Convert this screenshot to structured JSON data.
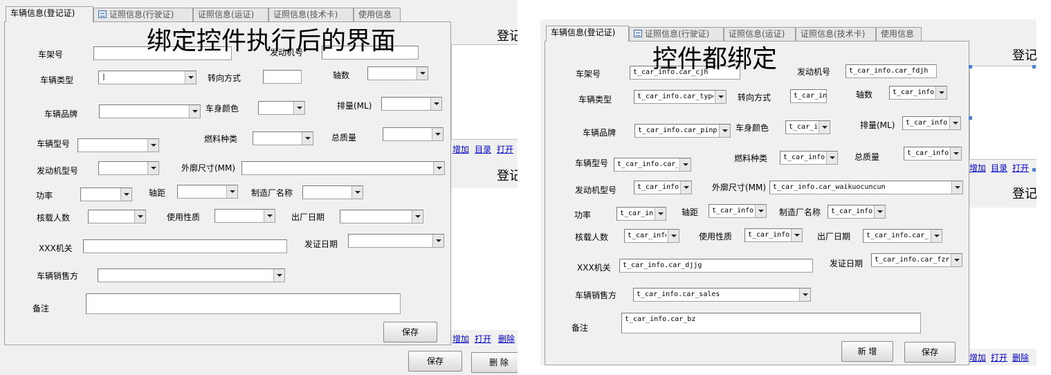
{
  "left": {
    "tabs": [
      {
        "label": "车辆信息(登记证)",
        "active": true
      },
      {
        "label": "证照信息(行驶证)",
        "icon": "document-icon"
      },
      {
        "label": "证照信息(运证)"
      },
      {
        "label": "证照信息(技术卡)"
      },
      {
        "label": "使用信息"
      }
    ],
    "caption": "绑定控件执行后的界面",
    "labels": {
      "cjh": "车架号",
      "fdjh": "发动机号",
      "cllx": "车辆类型",
      "zxfs": "转向方式",
      "zs": "轴数",
      "clpp": "车辆品牌",
      "csys": "车身颜色",
      "pl": "排量(ML)",
      "clxh": "车辆型号",
      "rlzl": "燃料种类",
      "zzl": "总质量",
      "fdjxh": "发动机型号",
      "wkcc": "外廓尺寸(MM)",
      "gl": "功率",
      "zj": "轴距",
      "zzcmc": "制造厂名称",
      "hzrs": "核载人数",
      "syxz": "使用性质",
      "ccrq": "出厂日期",
      "djjg": "XXX机关",
      "fzrq": "发证日期",
      "clxsf": "车辆销售方",
      "bz": "备注"
    },
    "values": {
      "cllx": "|"
    },
    "save_button": "保存",
    "bottom_save_button": "保存",
    "delete_button": "删 除",
    "side_title_1": "登记",
    "side_title_2": "登记",
    "links_top": [
      "增加",
      "目录",
      "打开"
    ],
    "links_bottom": [
      "增加",
      "打开",
      "删除"
    ]
  },
  "right": {
    "tabs": [
      {
        "label": "车辆信息(登记证)",
        "active": true
      },
      {
        "label": "证照信息(行驶证)",
        "icon": "document-icon"
      },
      {
        "label": "证照信息(运证)"
      },
      {
        "label": "证照信息(技术卡)"
      },
      {
        "label": "使用信息"
      }
    ],
    "caption": "控件都绑定",
    "labels": {
      "cjh": "车架号",
      "fdjh": "发动机号",
      "cllx": "车辆类型",
      "zxfs": "转向方式",
      "zs": "轴数",
      "clpp": "车辆品牌",
      "csys": "车身颜色",
      "pl": "排量(ML)",
      "clxh": "车辆型号",
      "rlzl": "燃料种类",
      "zzl": "总质量",
      "fdjxh": "发动机型号",
      "wkcc": "外廓尺寸(MM)",
      "gl": "功率",
      "zj": "轴距",
      "zzcmc": "制造厂名称",
      "hzrs": "核载人数",
      "syxz": "使用性质",
      "ccrq": "出厂日期",
      "djjg": "XXX机关",
      "fzrq": "发证日期",
      "clxsf": "车辆销售方",
      "bz": "备注"
    },
    "values": {
      "cjh": "t_car_info.car_cjh",
      "fdjh": "t_car_info.car_fdjh",
      "cllx": "t_car_info.car_type",
      "zxfs": "t_car_in",
      "zs": "t_car_info.",
      "clpp": "t_car_info.car_pinps",
      "csys": "t_car_i",
      "pl": "t_car_info.",
      "clxh": "t_car_info.car_",
      "rlzl": "t_car_info.",
      "zzl": "t_car_info.",
      "fdjxh": "t_car_info.",
      "wkcc": "t_car_info.car_waikuocuncun",
      "gl": "t_car_inf",
      "zj": "t_car_info.",
      "zzcmc": "t_car_info.",
      "hzrs": "t_car_info",
      "syxz": "t_car_info.",
      "ccrq": "t_car_info.car_c",
      "djjg": "t_car_info.car_djjg",
      "fzrq": "t_car_info.car_fzrq",
      "clxsf": "t_car_info.car_sales",
      "bz": "t_car_info.car_bz"
    },
    "add_button": "新 增",
    "save_button": "保存",
    "side_title_1": "登记",
    "side_title_2": "登记",
    "links_top": [
      "增加",
      "目录",
      "打开"
    ],
    "links_bottom": [
      "增加",
      "打开",
      "删除"
    ]
  }
}
